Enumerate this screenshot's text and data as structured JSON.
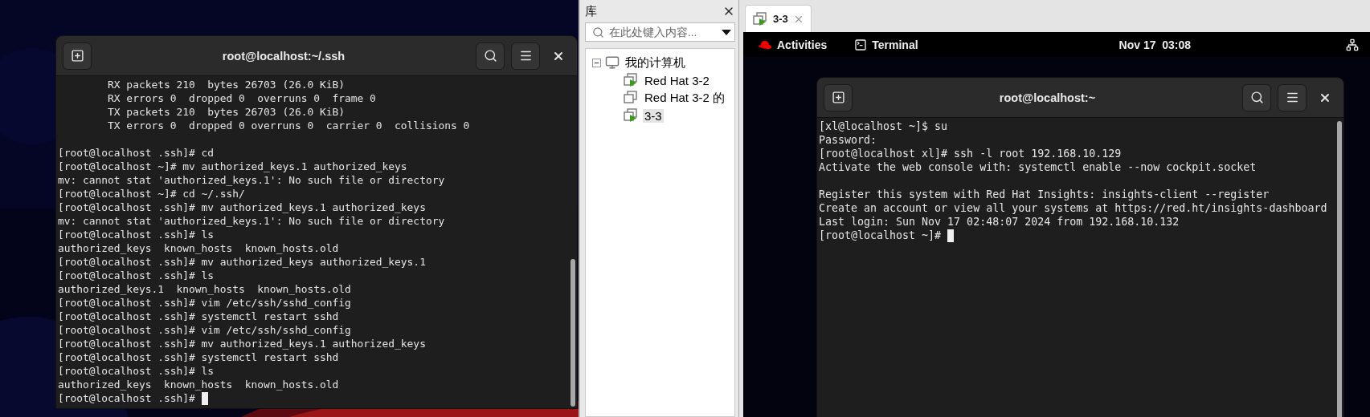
{
  "left_terminal": {
    "title": "root@localhost:~/.ssh",
    "cursor": true,
    "blocks": [
      [
        "        RX packets 210  bytes 26703 (26.0 KiB)",
        "        RX errors 0  dropped 0  overruns 0  frame 0",
        "        TX packets 210  bytes 26703 (26.0 KiB)",
        "        TX errors 0  dropped 0 overruns 0  carrier 0  collisions 0"
      ],
      [
        "[root@localhost .ssh]# cd",
        "[root@localhost ~]# mv authorized_keys.1 authorized_keys",
        "mv: cannot stat 'authorized_keys.1': No such file or directory",
        "[root@localhost ~]# cd ~/.ssh/",
        "[root@localhost .ssh]# mv authorized_keys.1 authorized_keys",
        "mv: cannot stat 'authorized_keys.1': No such file or directory",
        "[root@localhost .ssh]# ls",
        "authorized_keys  known_hosts  known_hosts.old",
        "[root@localhost .ssh]# mv authorized_keys authorized_keys.1",
        "[root@localhost .ssh]# ls",
        "authorized_keys.1  known_hosts  known_hosts.old",
        "[root@localhost .ssh]# vim /etc/ssh/sshd_config",
        "[root@localhost .ssh]# systemctl restart sshd",
        "[root@localhost .ssh]# vim /etc/ssh/sshd_config",
        "[root@localhost .ssh]# mv authorized_keys.1 authorized_keys",
        "[root@localhost .ssh]# systemctl restart sshd",
        "[root@localhost .ssh]# ls",
        "authorized_keys  known_hosts  known_hosts.old",
        "[root@localhost .ssh]# "
      ]
    ]
  },
  "library": {
    "title": "库",
    "search": {
      "placeholder": "在此处键入内容..."
    },
    "tree": [
      {
        "label": "我的计算机",
        "expanded": true,
        "children": [
          {
            "label": "Red Hat 3-2",
            "running": true,
            "selected": false
          },
          {
            "label": "Red Hat 3-2 的",
            "running": false,
            "selected": false
          },
          {
            "label": "3-3",
            "running": true,
            "selected": true
          }
        ]
      }
    ]
  },
  "vm_tabs": [
    {
      "label": "3-3",
      "selected": true,
      "running": true
    }
  ],
  "top_bar": {
    "activities": "Activities",
    "app": "Terminal",
    "clock": "Nov 17  03:08"
  },
  "right_terminal": {
    "title": "root@localhost:~",
    "cursor": true,
    "blocks": [
      [
        "[xl@localhost ~]$ su",
        "Password:",
        "[root@localhost xl]# ssh -l root 192.168.10.129",
        "Activate the web console with: systemctl enable --now cockpit.socket"
      ],
      [
        "Register this system with Red Hat Insights: insights-client --register",
        "Create an account or view all your systems at https://red.ht/insights-dashboard",
        "Last login: Sun Nov 17 02:48:07 2024 from 192.168.10.132",
        "[root@localhost ~]# "
      ]
    ]
  }
}
